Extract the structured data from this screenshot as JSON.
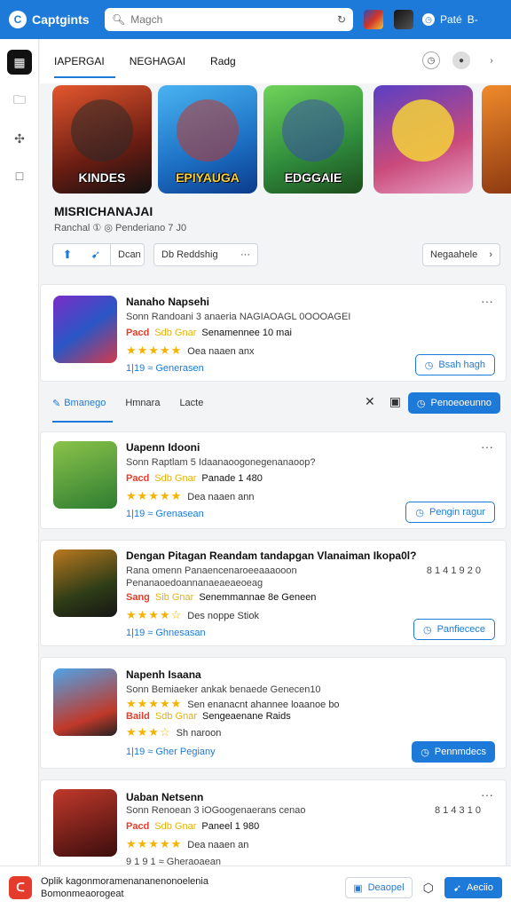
{
  "app": {
    "title": "Captgints",
    "logo_letter": "C"
  },
  "search": {
    "placeholder": "Magch"
  },
  "user": {
    "label": "Paté",
    "suffix": "B-"
  },
  "rail": {
    "items": [
      "grid-icon",
      "folder-icon",
      "puzzle-icon",
      "square-icon"
    ]
  },
  "tabs": [
    {
      "label": "IAPERGAI"
    },
    {
      "label": "NEGHAGAI"
    },
    {
      "label": "Radg"
    }
  ],
  "carousel": [
    {
      "title": "KINDES"
    },
    {
      "title": "EPIYAUGA"
    },
    {
      "title": "EDGGAIE"
    },
    {
      "title": ""
    },
    {
      "title": ""
    }
  ],
  "section": {
    "title": "MISRICHANAJAI",
    "subtitle": "Ranchal  ①  ◎ Penderiano 7 J0"
  },
  "filters": {
    "group_label": "Dcan",
    "select_label": "Db Reddshig",
    "sort_label": "Negaahele"
  },
  "cards": [
    {
      "name": "Nanaho Napsehi",
      "desc": "Sonn Randoani 3 anaeria NAGIAOAGL 0OOOAGEI",
      "genre_tag": "Pacd",
      "genre_sub": "Sdb Gnar",
      "genre_text": "Senamennee 10 mai",
      "rating_text": "Oea naaen anx",
      "meta": "1|19 ≈ Generasen",
      "button": "Bsah hagh",
      "right_note": ""
    },
    {
      "name": "Uapenn Idooni",
      "desc": "Sonn Raptlam 5 Idaanaoogonegenanaoop?",
      "genre_tag": "Pacd",
      "genre_sub": "Sdb Gnar",
      "genre_text": "Panade 1 480",
      "rating_text": "Dea naaen ann",
      "meta": "1|19 ≈ Grenasean",
      "button": "Pengin ragur",
      "right_note": ""
    },
    {
      "name": "Dengan Pitagan Reandam tandapgan Vlanaiman Ikopa0l?",
      "desc": "Rana omenn Panaencenaroeeaaaooon",
      "desc2": "Penanaoedoannanaeaeaeoeag",
      "genre_tag": "Sang",
      "genre_sub": "Sib Gnar",
      "genre_text": "Senemmannae 8e Geneen",
      "rating_text": "Des noppe Stiok",
      "meta": "1|19 ≈ Ghnesasan",
      "button": "Panfiecece",
      "right_note": "8 1 4 1 9 2 0"
    },
    {
      "name": "Napenh Isaana",
      "desc": "Sonn Bemiaeker ankak benaede Genecen10",
      "desc2": "Sen enanacnt ahannee loaanoe bo",
      "genre_tag": "Baild",
      "genre_sub": "Sdb Gnar",
      "genre_text": "Sengeaenane Raids",
      "rating_text": "Sh naroon",
      "meta": "1|19 ≈ Gher Pegiany",
      "button": "Pennmdecs",
      "right_note": ""
    },
    {
      "name": "Uaban Netsenn",
      "desc": "Sonn Renoean 3 iOGoogenaerans cenao",
      "genre_tag": "Pacd",
      "genre_sub": "Sdb Gnar",
      "genre_text": "Paneel 1 980",
      "rating_text": "Dea naaen an",
      "meta": "9 1 9 1 ≈ Gheraoaean",
      "button": "",
      "right_note": "8 1 4 3 1 0"
    }
  ],
  "tab2": {
    "items": [
      {
        "label": "Bmanego"
      },
      {
        "label": "Hmnara"
      },
      {
        "label": "Lacte"
      }
    ],
    "button": "Penoeoeunno"
  },
  "bottombar": {
    "line1": "Oplik kagonmoramenananenonoelenia",
    "line2": "Bomonmeaorogeat",
    "mid_button": "Deaopel",
    "cta": "Aeciio"
  },
  "colors": {
    "accent": "#1e7ad8",
    "tag_red": "#e43e2b",
    "star": "#f5b301"
  }
}
